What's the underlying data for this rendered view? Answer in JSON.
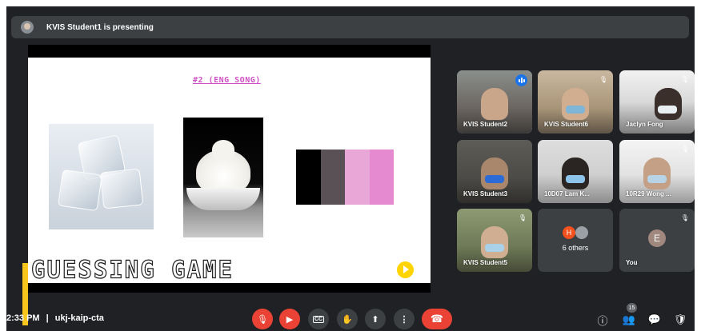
{
  "banner": {
    "text": "KVIS Student1 is presenting"
  },
  "slide": {
    "title": "#2 (ENG SONG)",
    "game_title": "GUESSING GAME",
    "palette": [
      "#000000",
      "#5a5157",
      "#e8a7d7",
      "#e58ad0"
    ]
  },
  "participants": [
    {
      "name": "KVIS Student2",
      "speaking": true,
      "muted": false
    },
    {
      "name": "KVIS Student6",
      "speaking": false,
      "muted": true
    },
    {
      "name": "Jaclyn Fong",
      "speaking": false,
      "muted": true
    },
    {
      "name": "KVIS Student3",
      "speaking": false,
      "muted": false
    },
    {
      "name": "10D07 Lam K...",
      "speaking": false,
      "muted": false
    },
    {
      "name": "10R29 Wong ...",
      "speaking": false,
      "muted": true
    },
    {
      "name": "KVIS Student5",
      "speaking": false,
      "muted": true
    }
  ],
  "others_tile": {
    "initial": "H",
    "label": "6 others"
  },
  "self_tile": {
    "initial": "E",
    "label": "You"
  },
  "meeting": {
    "time": "2:33 PM",
    "separator": "|",
    "code": "ukj-kaip-cta"
  },
  "controls": [
    "mic-off",
    "camera-off",
    "captions",
    "raise-hand",
    "present",
    "more",
    "end-call"
  ],
  "right_controls": {
    "people_count": "15"
  },
  "colors": {
    "accent": "#8ab4f8",
    "danger": "#ea4335",
    "bg": "#202124",
    "tile": "#3c4043"
  }
}
